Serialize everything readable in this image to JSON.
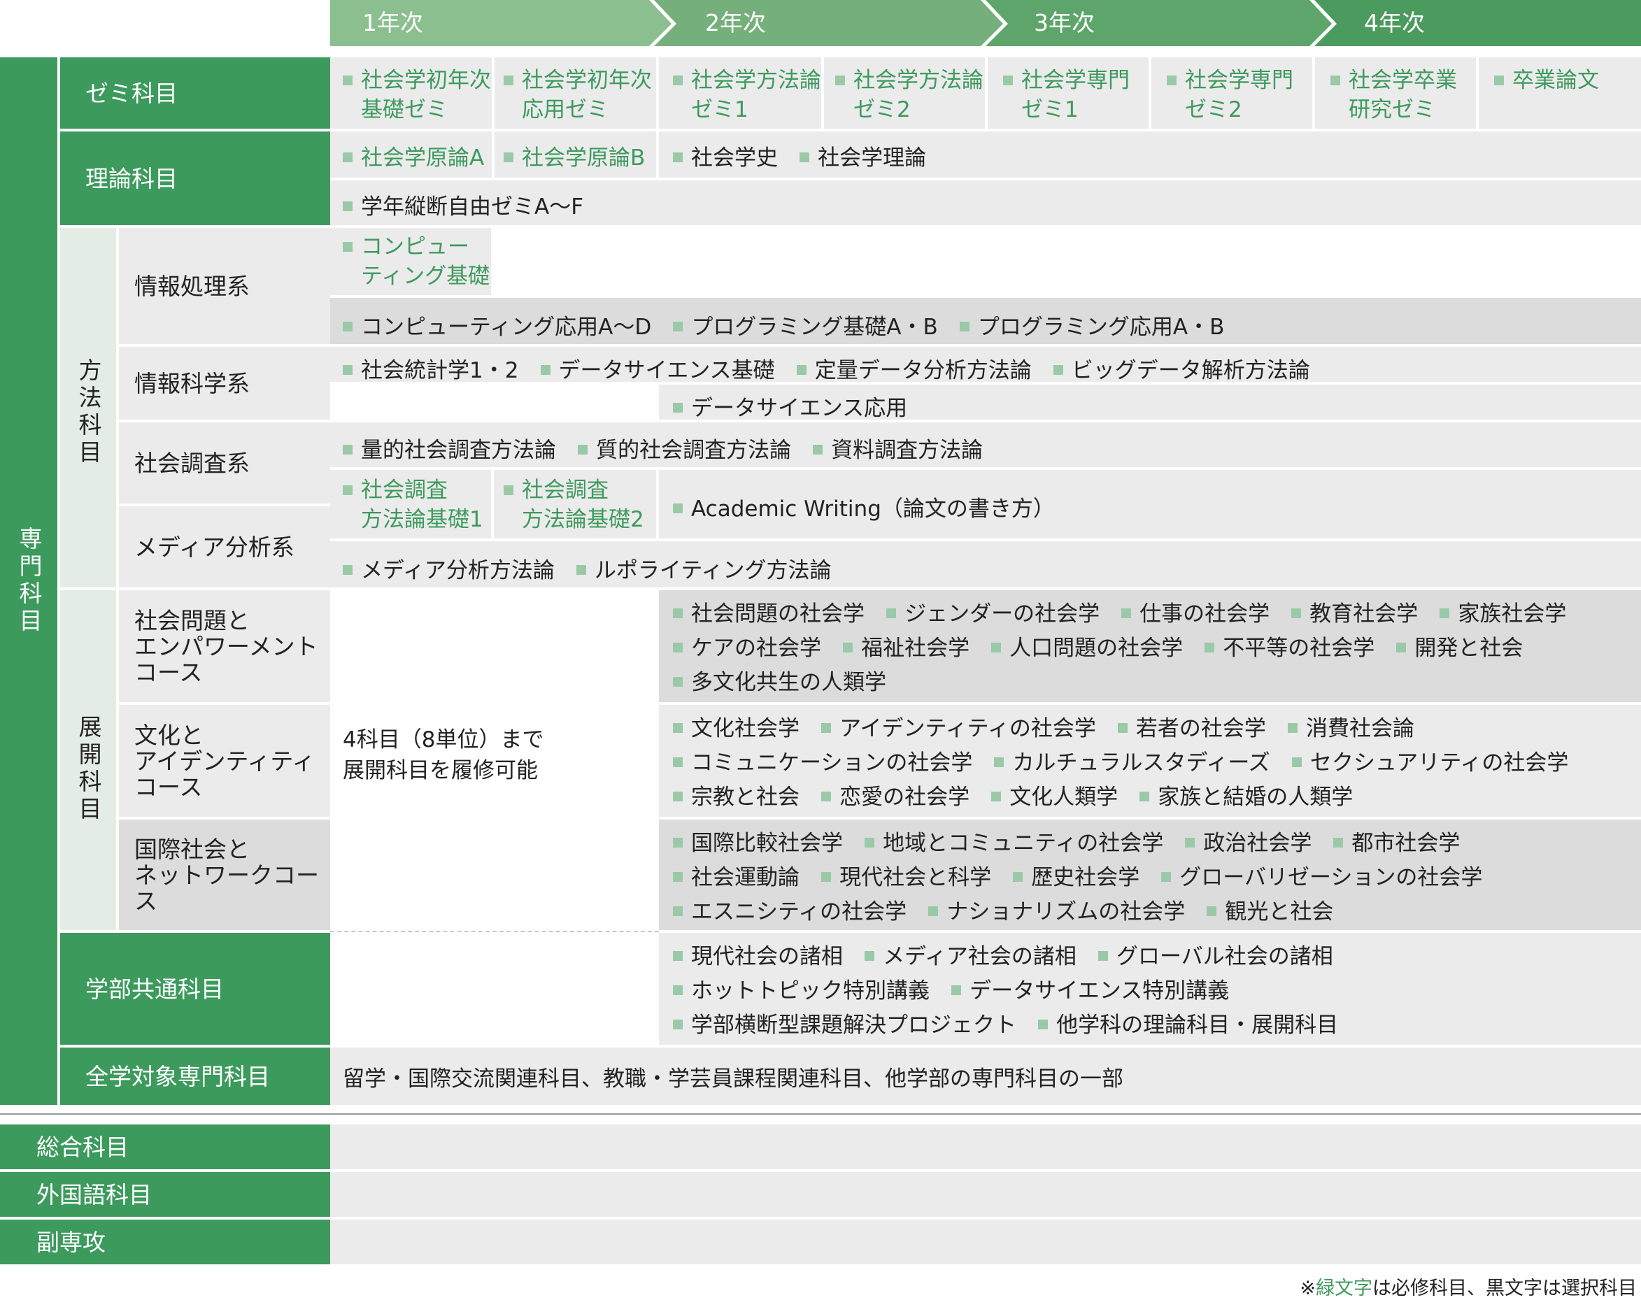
{
  "years": [
    "1年次",
    "2年次",
    "3年次",
    "4年次"
  ],
  "specialized": "専門科目",
  "method": "方法科目",
  "develop": "展開科目",
  "seminar": {
    "label": "ゼミ科目",
    "items": [
      [
        "社会学初年次",
        "基礎ゼミ"
      ],
      [
        "社会学初年次",
        "応用ゼミ"
      ],
      [
        "社会学方法論",
        "ゼミ1"
      ],
      [
        "社会学方法論",
        "ゼミ2"
      ],
      [
        "社会学専門",
        "ゼミ1"
      ],
      [
        "社会学専門",
        "ゼミ2"
      ],
      [
        "社会学卒業",
        "研究ゼミ"
      ],
      [
        "卒業論文",
        ""
      ]
    ]
  },
  "theory": {
    "label": "理論科目",
    "row1": [
      "社会学原論A",
      "社会学原論B",
      "社会学史",
      "社会学理論"
    ],
    "row2": "学年縦断自由ゼミA～F"
  },
  "info_proc": {
    "label": "情報処理系",
    "item1": [
      "コンピュー",
      "ティング基礎"
    ],
    "row2": [
      "コンピューティング応用A～D",
      "プログラミング基礎A・B",
      "プログラミング応用A・B"
    ]
  },
  "info_sci": {
    "label": "情報科学系",
    "row1": [
      "社会統計学1・2",
      "データサイエンス基礎",
      "定量データ分析方法論",
      "ビッグデータ解析方法論"
    ],
    "row2": "データサイエンス応用"
  },
  "survey": {
    "label": "社会調査系",
    "row1": [
      "量的社会調査方法論",
      "質的社会調査方法論",
      "資料調査方法論"
    ],
    "item_a": [
      "社会調査",
      "方法論基礎1"
    ],
    "item_b": [
      "社会調査",
      "方法論基礎2"
    ],
    "writing": "Academic Writing（論文の書き方）"
  },
  "media": {
    "label": "メディア分析系",
    "row": [
      "メディア分析方法論",
      "ルポライティング方法論"
    ]
  },
  "develop_note": [
    "4科目（8単位）まで",
    "展開科目を履修可能"
  ],
  "course1": {
    "label": [
      "社会問題と",
      "エンパワーメント",
      "コース"
    ],
    "rows": [
      [
        "社会問題の社会学",
        "ジェンダーの社会学",
        "仕事の社会学",
        "教育社会学",
        "家族社会学"
      ],
      [
        "ケアの社会学",
        "福祉社会学",
        "人口問題の社会学",
        "不平等の社会学",
        "開発と社会"
      ],
      [
        "多文化共生の人類学"
      ]
    ]
  },
  "course2": {
    "label": [
      "文化と",
      "アイデンティティ",
      "コース"
    ],
    "rows": [
      [
        "文化社会学",
        "アイデンティティの社会学",
        "若者の社会学",
        "消費社会論"
      ],
      [
        "コミュニケーションの社会学",
        "カルチュラルスタディーズ",
        "セクシュアリティの社会学"
      ],
      [
        "宗教と社会",
        "恋愛の社会学",
        "文化人類学",
        "家族と結婚の人類学"
      ]
    ]
  },
  "course3": {
    "label": [
      "国際社会と",
      "ネットワークコース"
    ],
    "rows": [
      [
        "国際比較社会学",
        "地域とコミュニティの社会学",
        "政治社会学",
        "都市社会学"
      ],
      [
        "社会運動論",
        "現代社会と科学",
        "歴史社会学",
        "グローバリゼーションの社会学"
      ],
      [
        "エスニシティの社会学",
        "ナショナリズムの社会学",
        "観光と社会"
      ]
    ]
  },
  "common": {
    "label": "学部共通科目",
    "rows": [
      [
        "現代社会の諸相",
        "メディア社会の諸相",
        "グローバル社会の諸相"
      ],
      [
        "ホットトピック特別講義",
        "データサイエンス特別講義"
      ],
      [
        "学部横断型課題解決プロジェクト",
        "他学科の理論科目・展開科目"
      ]
    ]
  },
  "all_uni": {
    "label": "全学対象専門科目",
    "text": "留学・国際交流関連科目、教職・学芸員課程関連科目、他学部の専門科目の一部"
  },
  "general": "総合科目",
  "foreign": "外国語科目",
  "minor": "副専攻",
  "footnote": {
    "mark": "※",
    "green": "緑文字",
    "rest": "は必修科目、黒文字は選択科目"
  },
  "colors": {
    "green": "#3d9a5d",
    "required_text": "#3d9a5d",
    "marker": "#9ac9a7",
    "cell_bg": "#ebebeb"
  }
}
